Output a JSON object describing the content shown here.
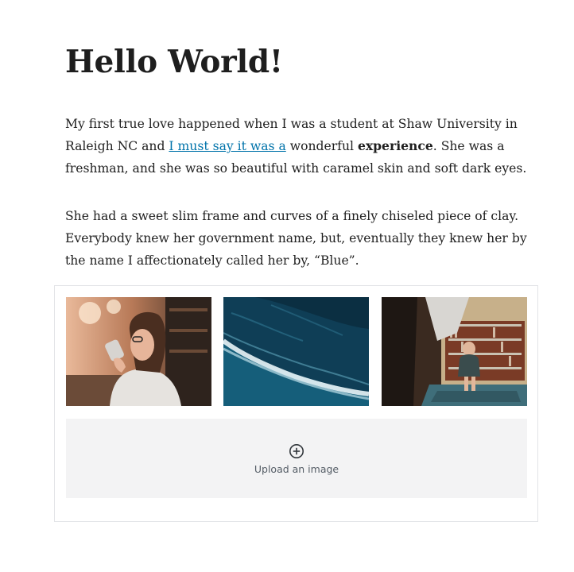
{
  "post": {
    "title": "Hello World!",
    "paragraph1": {
      "before_link": "My first true love happened when I was a student at Shaw University in Raleigh NC and ",
      "link_text": "I must say it was a",
      "between": " wonderful ",
      "bold_text": "experience",
      "after": ". She was a freshman, and she was so beautiful with caramel skin and soft dark eyes."
    },
    "paragraph2": "She had a sweet slim frame and curves of a finely chiseled piece of clay. Everybody knew her government name, but, eventually they knew her by the name I affectionately called her by, “Blue”."
  },
  "gallery": {
    "images": [
      {
        "icon": "photo-woman-drinking-coffee"
      },
      {
        "icon": "photo-ocean-waves-aerial"
      },
      {
        "icon": "photo-person-in-library"
      }
    ],
    "upload_label": "Upload an image",
    "upload_icon": "plus-circle-icon"
  }
}
